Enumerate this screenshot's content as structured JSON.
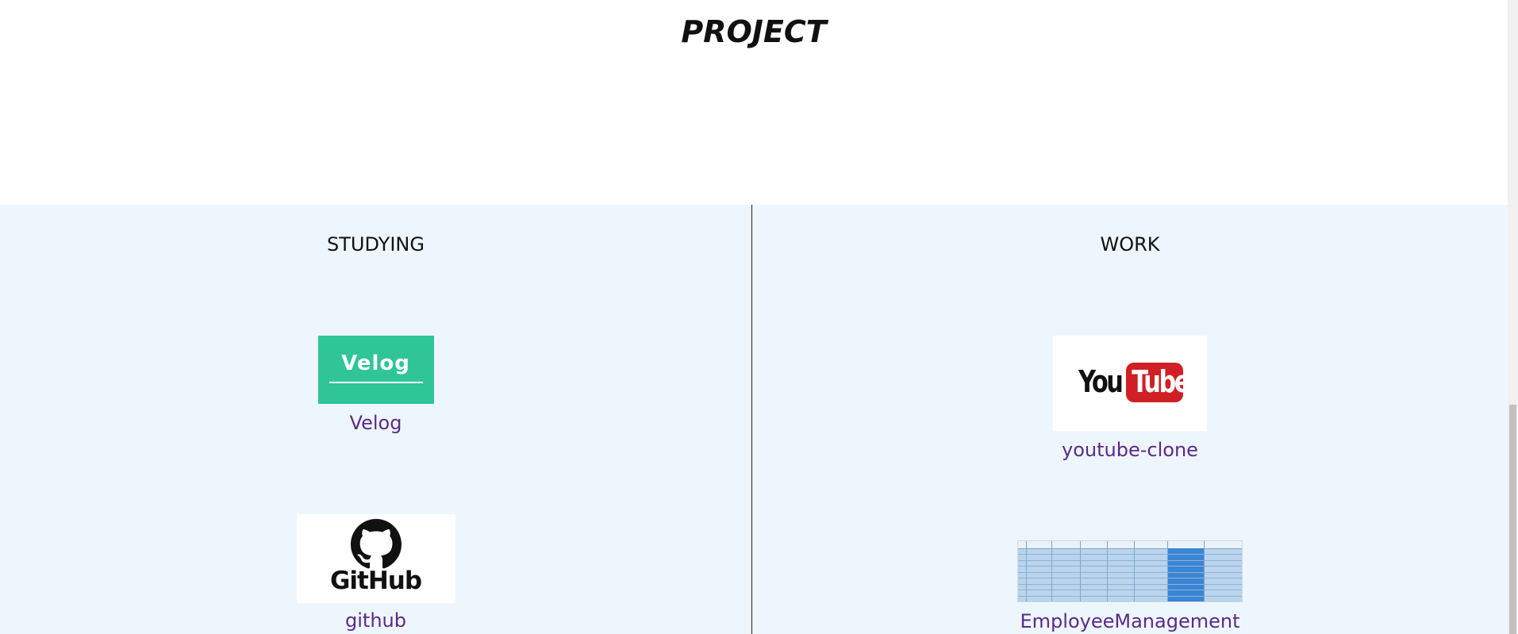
{
  "page": {
    "title": "PROJECT"
  },
  "studying": {
    "heading": "STUDYING",
    "items": [
      {
        "label": "Velog",
        "thumb_text": "Velog",
        "thumb_color": "#2fc597"
      },
      {
        "label": "github",
        "thumb_text": "GitHub"
      }
    ]
  },
  "work": {
    "heading": "WORK",
    "items": [
      {
        "label": "youtube-clone",
        "thumb_text_you": "You",
        "thumb_text_tube": "Tube",
        "thumb_color": "#d11f26"
      },
      {
        "label": "EmployeeManagement"
      }
    ]
  },
  "colors": {
    "band": "#eef6fd",
    "link": "#5b2a86",
    "divider": "#222222"
  }
}
